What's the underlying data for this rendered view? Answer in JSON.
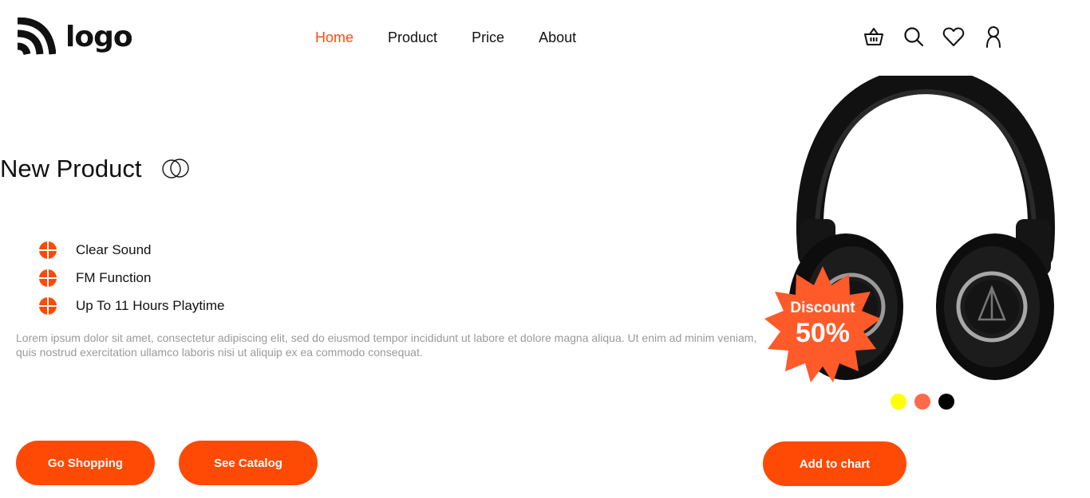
{
  "brand": {
    "logo_text": "logo"
  },
  "nav": {
    "items": [
      {
        "label": "Home",
        "active": true
      },
      {
        "label": "Product"
      },
      {
        "label": "Price"
      },
      {
        "label": "About"
      }
    ]
  },
  "header_icons": [
    "basket-icon",
    "search-icon",
    "heart-icon",
    "user-icon"
  ],
  "hero": {
    "title": "New Product",
    "features": [
      "Clear Sound",
      "FM Function",
      "Up To 11 Hours Playtime"
    ],
    "description": "Lorem ipsum dolor sit amet, consectetur adipiscing elit, sed do eiusmod tempor incididunt ut labore et dolore magna aliqua. Ut enim ad minim veniam, quis nostrud exercitation ullamco laboris nisi ut aliquip ex ea commodo consequat.",
    "buttons": {
      "shop": "Go Shopping",
      "catalog": "See Catalog"
    }
  },
  "product": {
    "discount_label": "Discount",
    "discount_value": "50%",
    "colors": [
      "#ffff00",
      "#ff6a4a",
      "#000000"
    ],
    "add_button": "Add to chart"
  },
  "theme": {
    "accent": "#ff4a06"
  }
}
